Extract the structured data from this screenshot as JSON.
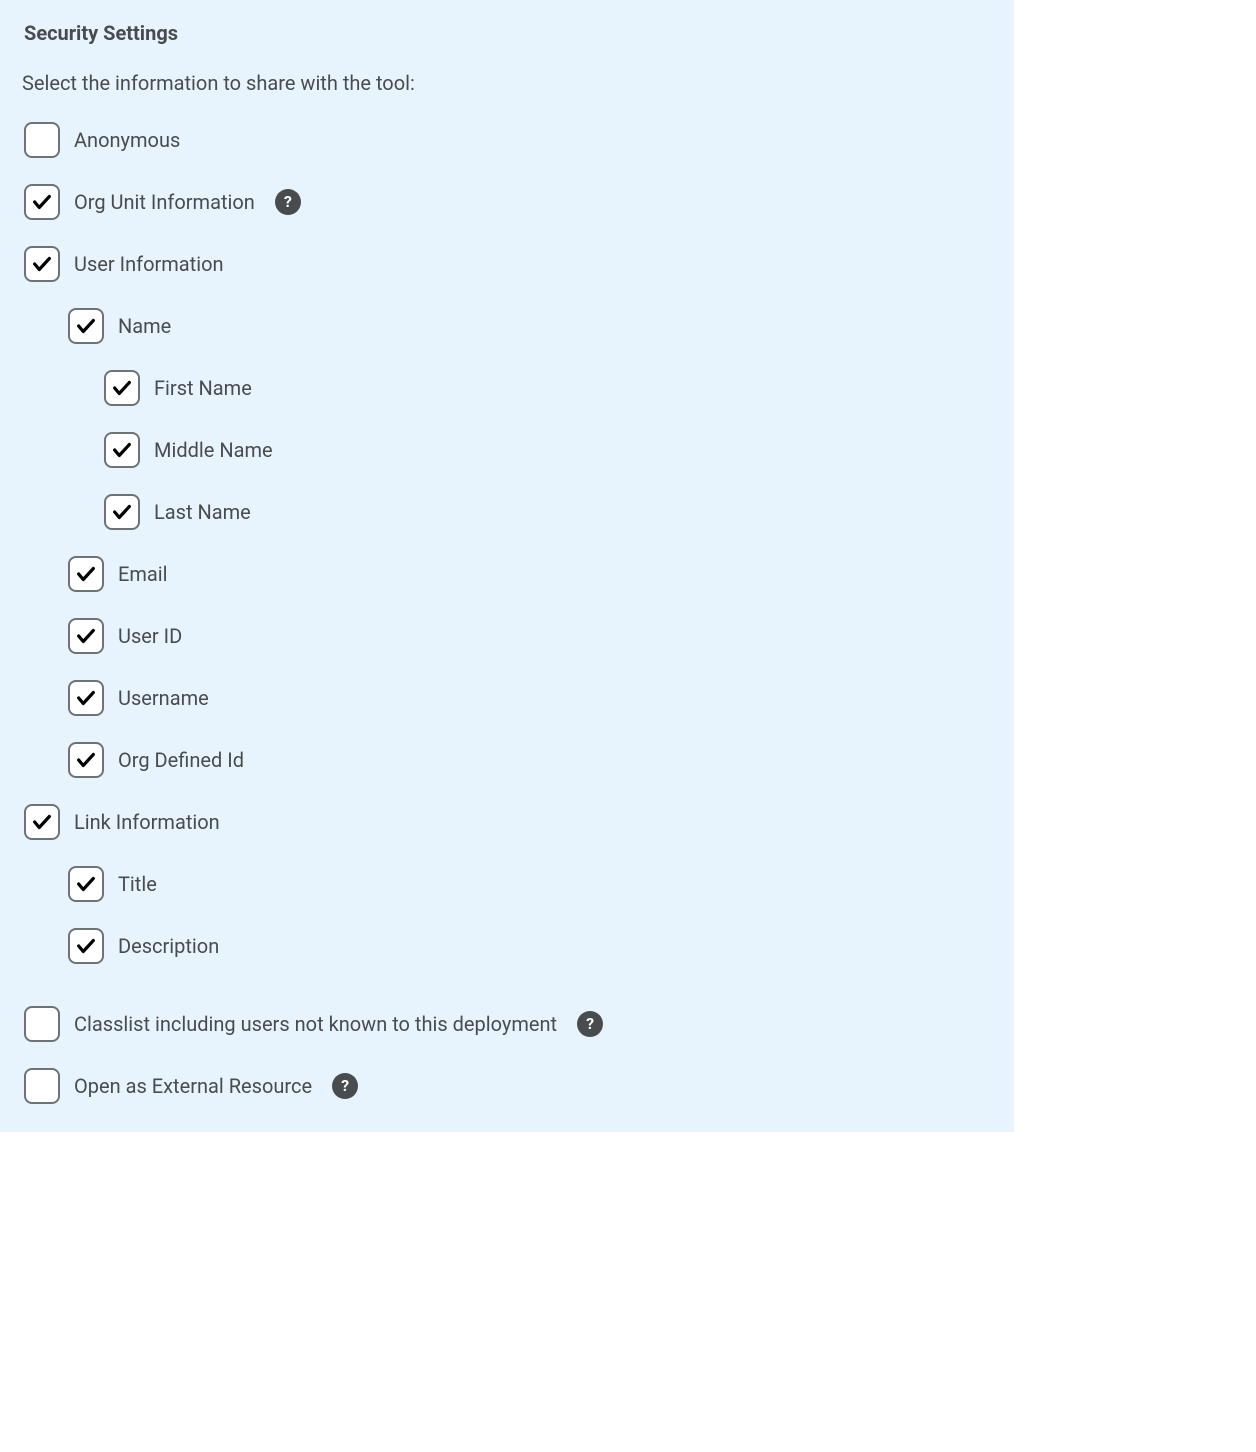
{
  "section": {
    "title": "Security Settings",
    "subtitle": "Select the information to share with the tool:"
  },
  "items": {
    "anonymous": {
      "label": "Anonymous",
      "checked": false,
      "help": false
    },
    "org_unit_info": {
      "label": "Org Unit Information",
      "checked": true,
      "help": true
    },
    "user_info": {
      "label": "User Information",
      "checked": true,
      "help": false
    },
    "name": {
      "label": "Name",
      "checked": true
    },
    "first_name": {
      "label": "First Name",
      "checked": true
    },
    "middle_name": {
      "label": "Middle Name",
      "checked": true
    },
    "last_name": {
      "label": "Last Name",
      "checked": true
    },
    "email": {
      "label": "Email",
      "checked": true
    },
    "user_id": {
      "label": "User ID",
      "checked": true
    },
    "username": {
      "label": "Username",
      "checked": true
    },
    "org_defined_id": {
      "label": "Org Defined Id",
      "checked": true
    },
    "link_info": {
      "label": "Link Information",
      "checked": true,
      "help": false
    },
    "title": {
      "label": "Title",
      "checked": true
    },
    "description": {
      "label": "Description",
      "checked": true
    },
    "classlist": {
      "label": "Classlist including users not known to this deployment",
      "checked": false,
      "help": true
    },
    "open_external": {
      "label": "Open as External Resource",
      "checked": false,
      "help": true
    }
  }
}
